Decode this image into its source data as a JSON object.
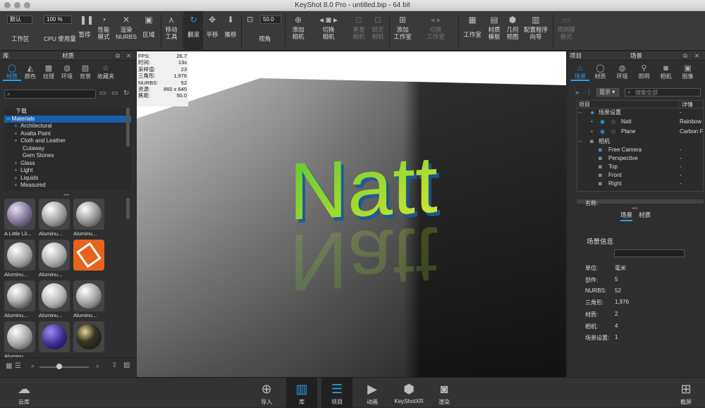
{
  "window": {
    "title": "KeyShot 8.0 Pro  - untitled.bip  - 64 bit"
  },
  "toolbar": {
    "workspace_value": "默认",
    "workspace_label": "工作区",
    "cpu_value": "100 %",
    "cpu_label": "CPU 使用量",
    "pause": "暂停",
    "perf_mode": "性能\n模式",
    "render_nurbs": "渲染\nNURBS",
    "region": "区域",
    "move_tool": "移动\n工具",
    "tumble": "翻滚",
    "pan": "平移",
    "dolly": "推移",
    "fov_value": "50.0",
    "fov_label": "视角",
    "add_camera": "添加\n相机",
    "switch_camera": "切换\n相机",
    "reset_camera": "重置\n相机",
    "lock_camera": "锁定\n相机",
    "add_studio": "添加\n工作室",
    "switch_studio": "切换\n工作室",
    "studio": "工作室",
    "material_template": "材质\n模板",
    "geometry_view": "几何\n视图",
    "config_wizard": "配置程序\n向导",
    "vr_mode": "视网膜\n模式"
  },
  "library": {
    "title": "库",
    "subtitle": "材质",
    "tabs": [
      "材质",
      "颜色",
      "纹理",
      "环境",
      "背景",
      "收藏夹"
    ],
    "tree": [
      "下载",
      "Materials",
      "Architectural",
      "Axalta Paint",
      "Cloth and Leather",
      "Cutaway",
      "Gem Stones",
      "Glass",
      "Light",
      "Liquids",
      "Measured"
    ],
    "thumbs": [
      "A Little Lil...",
      "Aluminu...",
      "Aluminu...",
      "Aluminu...",
      "Aluminu...",
      "",
      "Aluminu...",
      "Aluminu...",
      "Aluminu...",
      "Aluminu...",
      "",
      ""
    ]
  },
  "hud": [
    {
      "k": "FPS:",
      "v": "26.7"
    },
    {
      "k": "时间:",
      "v": "13s"
    },
    {
      "k": "采样值:",
      "v": "23"
    },
    {
      "k": "三角形:",
      "v": "1,976"
    },
    {
      "k": "NURBS:",
      "v": "52"
    },
    {
      "k": "资源:",
      "v": "860 x 645"
    },
    {
      "k": "焦距:",
      "v": "50.0"
    }
  ],
  "scene_text": "Natt",
  "project": {
    "title": "项目",
    "subtitle": "场景",
    "tabs": [
      "场景",
      "材质",
      "环境",
      "照明",
      "相机",
      "图像"
    ],
    "show_label": "显示",
    "search_placeholder": "搜索全部",
    "col_item": "项目",
    "col_detail": "详情",
    "rows": [
      {
        "name": "场景设置",
        "detail": "-"
      },
      {
        "name": "Natt",
        "detail": "Rainbow"
      },
      {
        "name": "Plane",
        "detail": "Carbon F"
      },
      {
        "name": "相机",
        "detail": ""
      },
      {
        "name": "Free Camera",
        "detail": "-"
      },
      {
        "name": "Perspective",
        "detail": "-"
      },
      {
        "name": "Top",
        "detail": "-"
      },
      {
        "name": "Front",
        "detail": "-"
      },
      {
        "name": "Right",
        "detail": "-"
      }
    ],
    "subtabs": [
      "场景",
      "材质"
    ],
    "info_title": "场景信息",
    "info": [
      {
        "k": "名称:",
        "v": ""
      },
      {
        "k": "单位:",
        "v": "毫米"
      },
      {
        "k": "部件:",
        "v": "5"
      },
      {
        "k": "NURBS:",
        "v": "52"
      },
      {
        "k": "三角形:",
        "v": "1,976"
      },
      {
        "k": "材质:",
        "v": "2"
      },
      {
        "k": "相机:",
        "v": "4"
      },
      {
        "k": "场景设置:",
        "v": "1"
      }
    ]
  },
  "bottom": {
    "cloud": "云库",
    "import": "导入",
    "library": "库",
    "project": "项目",
    "animation": "动画",
    "keyshotxr": "KeyShotXR",
    "render": "渲染",
    "screenshot": "截屏"
  }
}
